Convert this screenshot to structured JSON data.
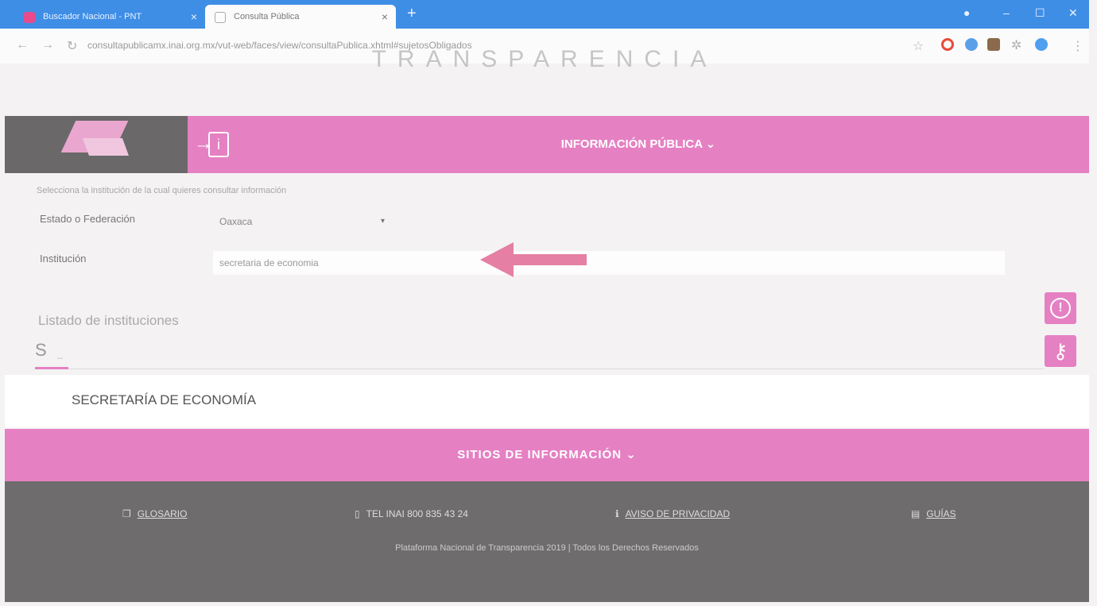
{
  "browser": {
    "tabs": [
      {
        "title": "Buscador Nacional - PNT"
      },
      {
        "title": "Consulta Pública"
      }
    ],
    "new_tab": "+",
    "url": "consultapublicamx.inai.org.mx/vut-web/faces/view/consultaPublica.xhtml#sujetosObligados",
    "window": {
      "minimize": "–",
      "maximize": "☐",
      "close": "✕"
    }
  },
  "header": {
    "brand": "TRANSPARENCIA"
  },
  "nav": {
    "label": "INFORMACIÓN PÚBLICA ⌄",
    "info_icon_text": "i"
  },
  "form": {
    "hint": "Selecciona la institución de la cual quieres consultar información",
    "estado_label": "Estado o Federación",
    "estado_value": "Oaxaca",
    "institucion_label": "Institución",
    "institucion_value": "secretaria de economia"
  },
  "listado": {
    "title": "Listado de instituciones",
    "typed": "S",
    "cursor": "_",
    "result": "SECRETARÍA DE ECONOMÍA"
  },
  "side_buttons": {
    "alert_symbol": "!",
    "key_symbol": "⚷"
  },
  "sitios": {
    "label": "SITIOS DE INFORMACIÓN ⌄"
  },
  "footer": {
    "glosario": "GLOSARIO",
    "tel": "TEL INAI 800 835 43 24",
    "aviso": "AVISO DE PRIVACIDAD",
    "guias": "GUÍAS",
    "copyright": "Plataforma Nacional de Transparencia 2019 | Todos los Derechos Reservados"
  },
  "colors": {
    "accent_pink": "#e580c3",
    "footer_gray": "#6e6c6c",
    "chrome_blue": "#3f8ee6",
    "arrow_pink": "#e57fa3"
  }
}
